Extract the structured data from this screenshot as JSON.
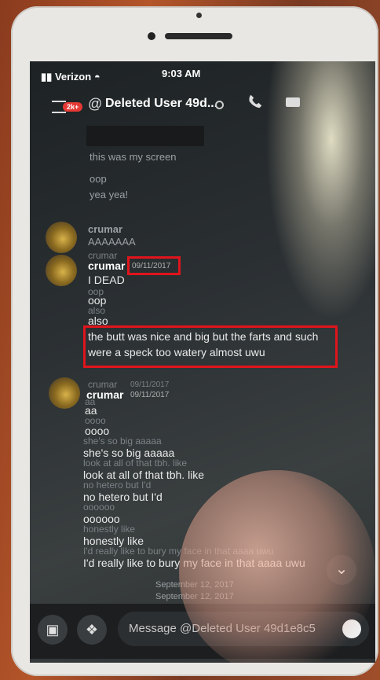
{
  "status_bar": {
    "carrier": "Verizon",
    "time": "9:03 AM"
  },
  "header": {
    "unread_badge": "2k+",
    "at_symbol": "@",
    "channel_title": "Deleted User 49d..."
  },
  "messages": {
    "pre": [
      "this was my screen",
      "oop",
      "yea yea!"
    ],
    "group1": {
      "author": "crumar",
      "lines": [
        "AAAAAAA"
      ],
      "ghost_author": "crumar",
      "ghost_lines": [
        "I DEAD"
      ]
    },
    "group2": {
      "author": "crumar",
      "timestamp": "09/11/2017",
      "lines": [
        "I DEAD",
        "oop",
        "also"
      ],
      "ghost_lines": [
        "oop",
        "also"
      ],
      "highlight_lines": [
        "the butt was nice and big but the farts and such",
        "were a speck too watery almost uwu"
      ]
    },
    "group3": {
      "ghost_author": "crumar",
      "ghost_timestamp": "09/11/2017",
      "author": "crumar",
      "timestamp": "09/11/2017",
      "lines": [
        "aa",
        "oooo",
        "she's so big aaaaa",
        "look at all of that tbh. like",
        "no hetero but I'd",
        "oooooo",
        "honestly like",
        "I'd really like to bury my face in that aaaa uwu"
      ],
      "ghost_lines": [
        "aa",
        "oooo",
        "she's so big aaaaa",
        "look at all of that tbh. like",
        "no hetero but I'd",
        "oooooo",
        "honestly like",
        "I'd really like to bury my face in that aaaa uwu"
      ]
    },
    "date_dividers": [
      "September 12, 2017",
      "September 12, 2017"
    ]
  },
  "input": {
    "placeholder": "Message @Deleted User 49d1e8c5"
  },
  "icons": {
    "jump": "chevron-down-icon",
    "image": "image-icon",
    "gift": "gift-icon",
    "emoji": "emoji-icon"
  }
}
